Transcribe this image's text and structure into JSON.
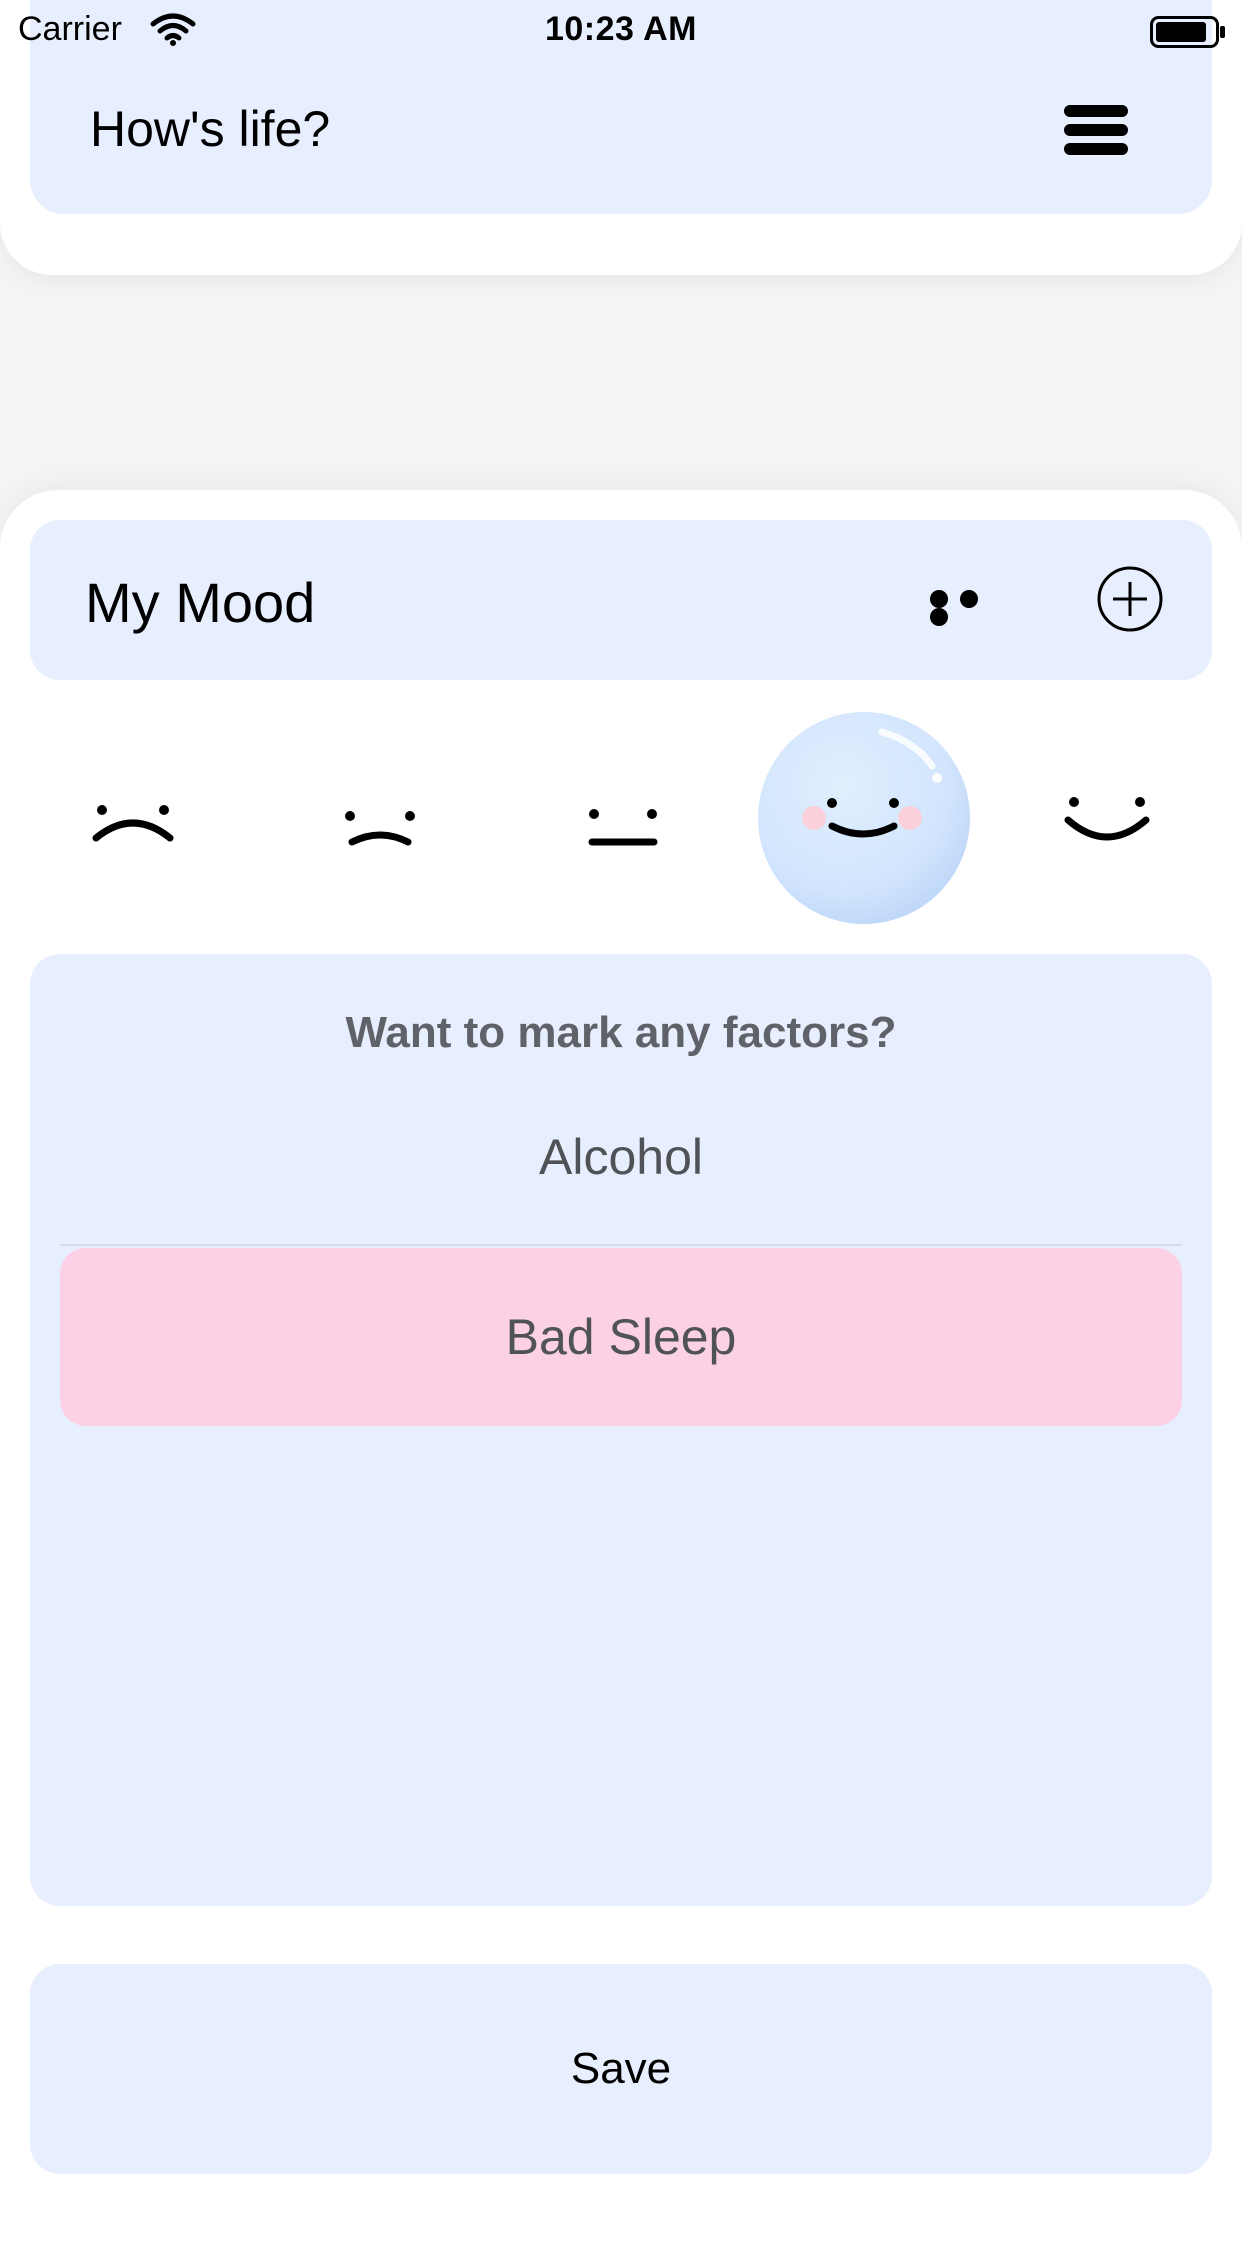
{
  "status_bar": {
    "carrier": "Carrier",
    "time": "10:23 AM"
  },
  "header": {
    "title": "How's life?",
    "menu_icon": "hamburger-menu-icon"
  },
  "mood_card": {
    "title": "My Mood",
    "more_icon": "ellipsis-icon",
    "add_icon": "plus-circle-icon",
    "moods": [
      {
        "name": "very-sad",
        "selected": false
      },
      {
        "name": "sad",
        "selected": false
      },
      {
        "name": "neutral",
        "selected": false
      },
      {
        "name": "happy",
        "selected": true
      },
      {
        "name": "very-happy",
        "selected": false
      }
    ]
  },
  "factors": {
    "prompt": "Want to mark any factors?",
    "items": [
      {
        "label": "Alcohol",
        "selected": false
      },
      {
        "label": "Bad Sleep",
        "selected": true
      }
    ]
  },
  "save_label": "Save",
  "colors": {
    "panel": "#e7eefd",
    "selected_factor": "#fdd1e5",
    "selected_mood": "#d3e6fd"
  }
}
